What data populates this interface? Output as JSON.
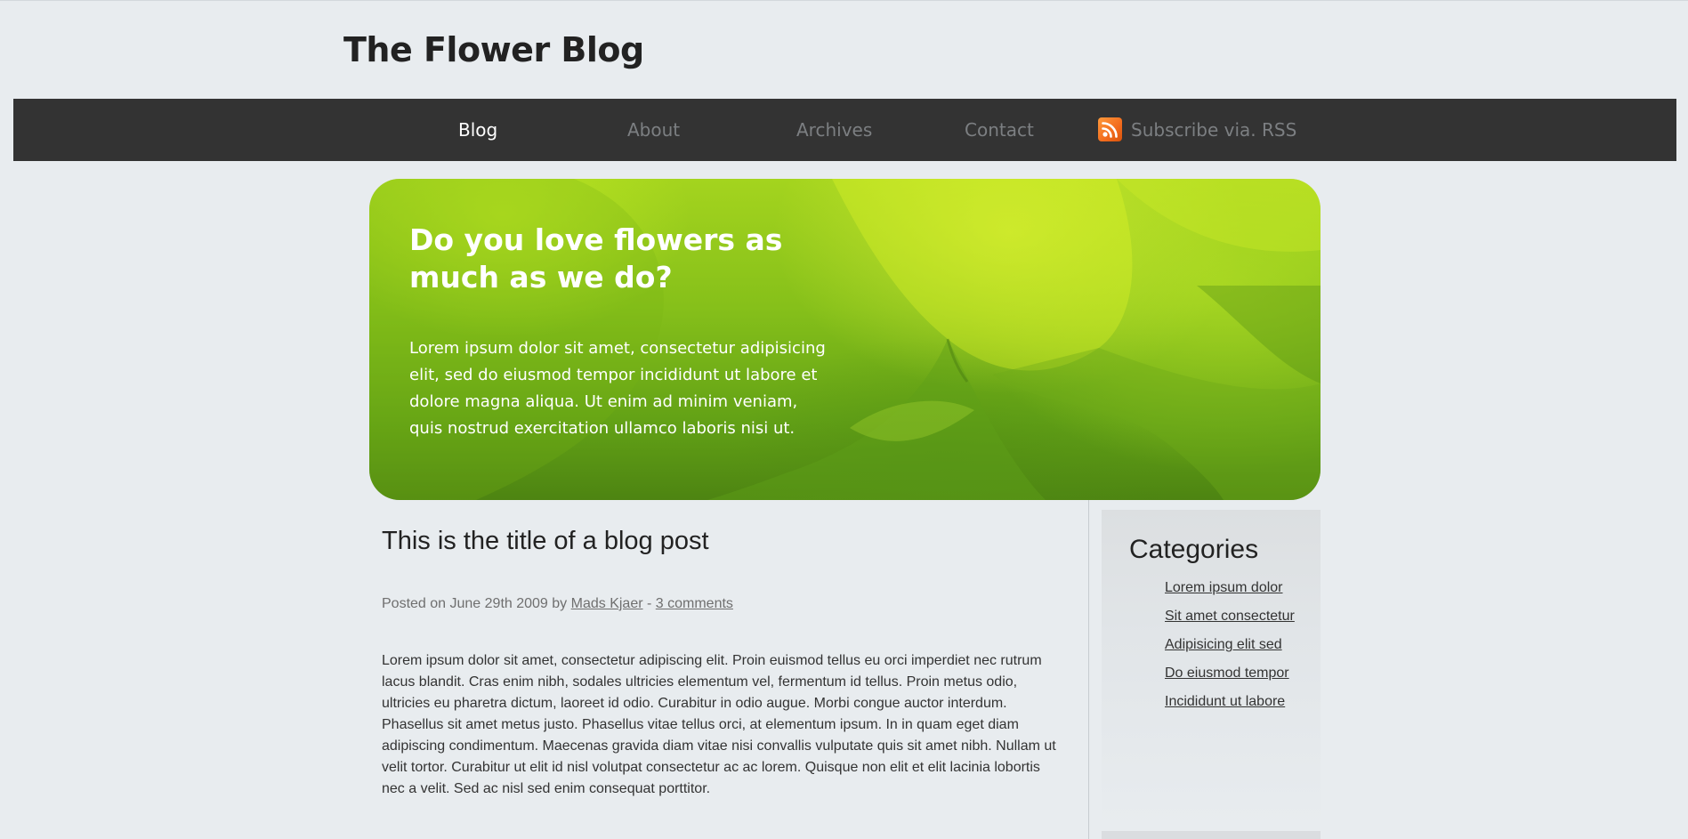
{
  "site": {
    "title": "The Flower Blog"
  },
  "nav": {
    "items": [
      {
        "label": "Blog",
        "active": true
      },
      {
        "label": "About",
        "active": false
      },
      {
        "label": "Archives",
        "active": false
      },
      {
        "label": "Contact",
        "active": false
      }
    ],
    "rss": {
      "label": "Subscribe via. RSS",
      "icon": "rss-icon"
    }
  },
  "hero": {
    "heading": "Do you love flowers as much as we do?",
    "text": "Lorem ipsum dolor sit amet, consectetur adipisicing elit, sed do eiusmod tempor incididunt ut labore et dolore magna aliqua. Ut enim ad minim veniam, quis nostrud exercitation ullamco laboris nisi ut."
  },
  "post": {
    "title": "This is the title of a blog post",
    "meta": {
      "prefix": "Posted on June 29th 2009 by",
      "author": "Mads Kjaer",
      "separator": "-",
      "comments": "3 comments"
    },
    "body": "Lorem ipsum dolor sit amet, consectetur adipiscing elit. Proin euismod tellus eu orci imperdiet nec rutrum lacus blandit. Cras enim nibh, sodales ultricies elementum vel, fermentum id tellus. Proin metus odio, ultricies eu pharetra dictum, laoreet id odio. Curabitur in odio augue. Morbi congue auctor interdum. Phasellus sit amet metus justo. Phasellus vitae tellus orci, at elementum ipsum. In in quam eget diam adipiscing condimentum. Maecenas gravida diam vitae nisi convallis vulputate quis sit amet nibh. Nullam ut velit tortor. Curabitur ut elit id nisl volutpat consectetur ac ac lorem. Quisque non elit et elit lacinia lobortis nec a velit. Sed ac nisl sed enim consequat porttitor."
  },
  "sidebar": {
    "heading": "Categories",
    "categories": [
      "Lorem ipsum dolor",
      "Sit amet consectetur",
      "Adipisicing elit sed",
      "Do eiusmod tempor",
      "Incididunt ut labore"
    ]
  },
  "colors": {
    "page_background": "#e8ecef",
    "navbar": "#333333",
    "nav_inactive": "#7c7f82",
    "nav_active": "#ffffff",
    "hero_green": "#86c01a",
    "rss_orange": "#f26b1d"
  }
}
